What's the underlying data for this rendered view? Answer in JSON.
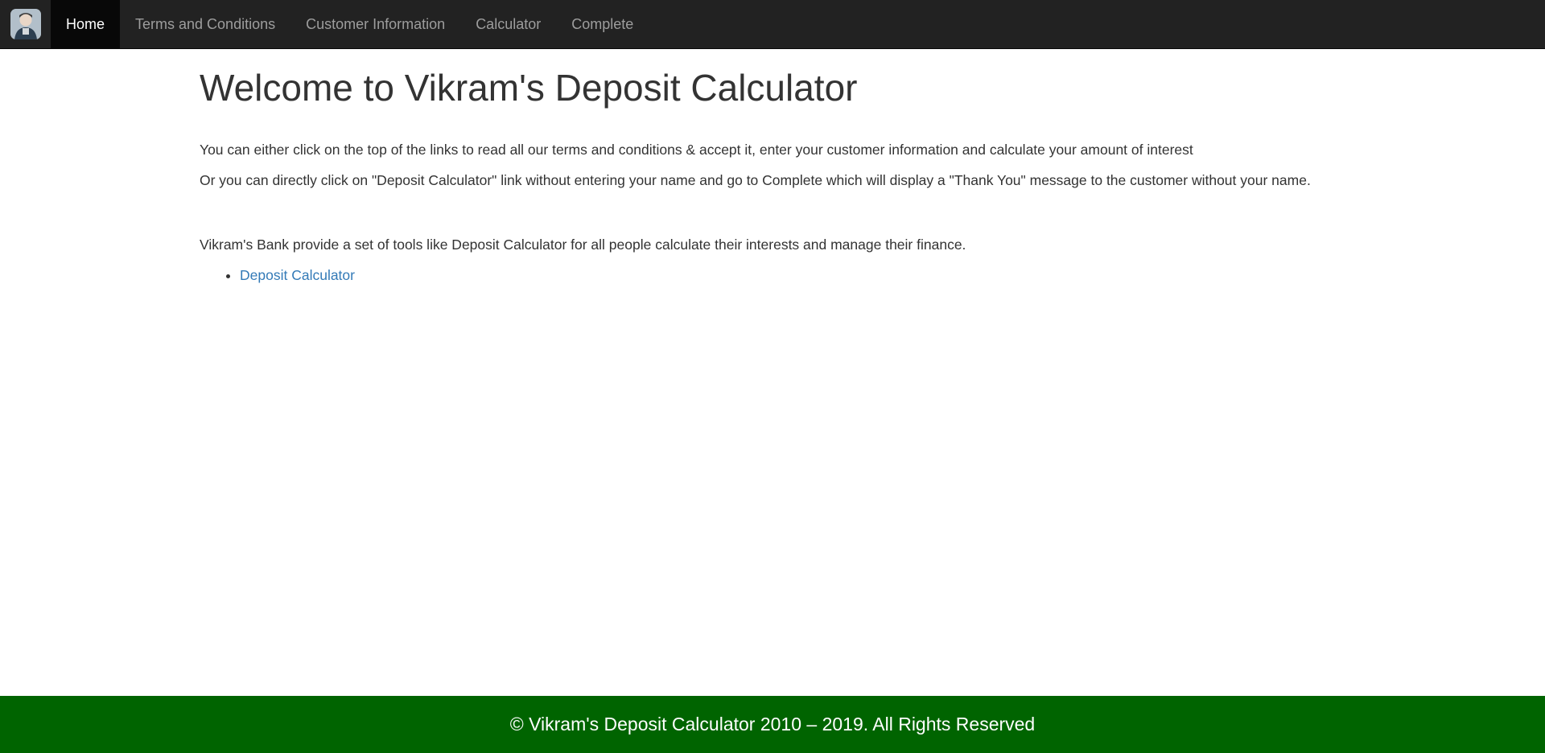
{
  "nav": {
    "brand_icon": "user-avatar-icon",
    "items": [
      {
        "label": "Home",
        "active": true
      },
      {
        "label": "Terms and Conditions",
        "active": false
      },
      {
        "label": "Customer Information",
        "active": false
      },
      {
        "label": "Calculator",
        "active": false
      },
      {
        "label": "Complete",
        "active": false
      }
    ]
  },
  "main": {
    "title": "Welcome to Vikram's Deposit Calculator",
    "paragraphs": [
      "You can either click on the top of the links to read all our terms and conditions & accept it, enter your customer information and calculate your amount of interest",
      "Or you can directly click on \"Deposit Calculator\" link without entering your name and go to Complete which will display a \"Thank You\" message to the customer without your name."
    ],
    "tools_text": "Vikram's Bank provide a set of tools like Deposit Calculator for all people calculate their interests and manage their finance.",
    "links": [
      "Deposit Calculator"
    ]
  },
  "footer": {
    "text": "© Vikram's Deposit Calculator 2010 – 2019. All Rights Reserved"
  },
  "colors": {
    "navbar_bg": "#222222",
    "nav_active_bg": "#080808",
    "link": "#337ab7",
    "footer_bg": "#006400"
  }
}
